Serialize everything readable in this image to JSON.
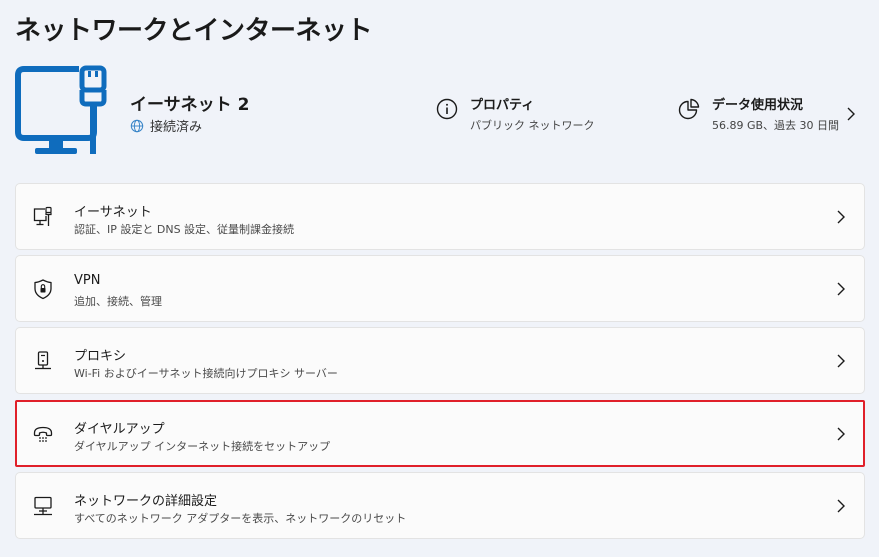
{
  "page": {
    "title": "ネットワークとインターネット"
  },
  "hero": {
    "adapter_name": "イーサネット 2",
    "status": "接続済み",
    "properties": {
      "title": "プロパティ",
      "subtitle": "パブリック ネットワーク",
      "icon": "info-icon"
    },
    "data_usage": {
      "title": "データ使用状況",
      "subtitle": "56.89 GB、過去 30 日間",
      "icon": "pie-chart-icon"
    }
  },
  "settings": [
    {
      "title": "イーサネット",
      "subtitle": "認証、IP 設定と DNS 設定、従量制課金接続",
      "icon": "ethernet-icon"
    },
    {
      "title": "VPN",
      "subtitle": "追加、接続、管理",
      "icon": "shield-icon"
    },
    {
      "title": "プロキシ",
      "subtitle": "Wi-Fi およびイーサネット接続向けプロキシ サーバー",
      "icon": "proxy-server-icon"
    },
    {
      "title": "ダイヤルアップ",
      "subtitle": "ダイヤルアップ インターネット接続をセットアップ",
      "icon": "dialup-phone-icon",
      "highlighted": true
    },
    {
      "title": "ネットワークの詳細設定",
      "subtitle": "すべてのネットワーク アダプターを表示、ネットワークのリセット",
      "icon": "network-computer-icon"
    }
  ],
  "colors": {
    "accent": "#0f6cbd",
    "highlight_border": "#e0202a",
    "background": "#f0f3f9",
    "card": "#fbfbfb"
  }
}
